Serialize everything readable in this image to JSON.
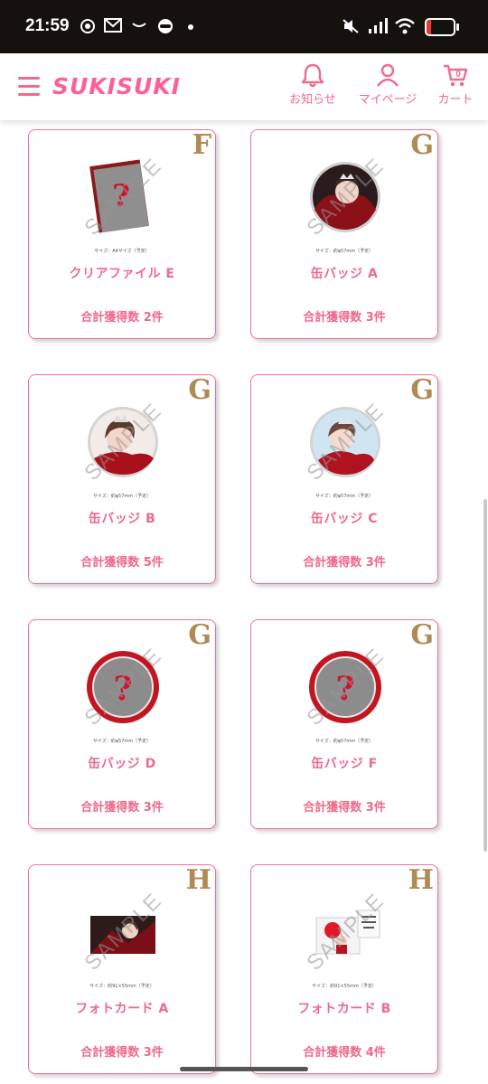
{
  "status_bar": {
    "time": "21:59",
    "battery": "17",
    "battery_level": 0.17,
    "icons": [
      "record-icon",
      "mail-icon",
      "wave-icon",
      "app-icon",
      "dot-icon",
      "mute-icon",
      "signal-icon",
      "wifi-icon",
      "battery-icon"
    ]
  },
  "header": {
    "logo": "SUKISUKI",
    "nav": [
      {
        "label": "お知らせ",
        "icon": "bell-icon"
      },
      {
        "label": "マイページ",
        "icon": "user-icon"
      },
      {
        "label": "カート",
        "icon": "cart-icon",
        "badge": "0"
      }
    ]
  },
  "colors": {
    "accent": "#ef6a8c",
    "rank": "#b08a55",
    "status_bar": "#15120e"
  },
  "watermark": "SAMPLE",
  "cards": [
    {
      "rank": "F",
      "name": "クリアファイル E",
      "count": "合計獲得数 2件",
      "caption": "サイズ：A4サイズ（予定）",
      "thumb": "clear-file"
    },
    {
      "rank": "G",
      "name": "缶バッジ A",
      "count": "合計獲得数 3件",
      "caption": "サイズ：約φ57mm（予定）",
      "thumb": "badge-photo-dark"
    },
    {
      "rank": "G",
      "name": "缶バッジ B",
      "count": "合計獲得数 5件",
      "caption": "サイズ：約φ57mm（予定）",
      "thumb": "badge-photo-light"
    },
    {
      "rank": "G",
      "name": "缶バッジ C",
      "count": "合計獲得数 3件",
      "caption": "サイズ：約φ57mm（予定）",
      "thumb": "badge-photo-blue"
    },
    {
      "rank": "G",
      "name": "缶バッジ D",
      "count": "合計獲得数 3件",
      "caption": "サイズ：約φ57mm（予定）",
      "thumb": "badge-mystery"
    },
    {
      "rank": "G",
      "name": "缶バッジ F",
      "count": "合計獲得数 3件",
      "caption": "サイズ：約φ57mm（予定）",
      "thumb": "badge-mystery"
    },
    {
      "rank": "H",
      "name": "フォトカード A",
      "count": "合計獲得数 3件",
      "caption": "サイズ：約91×55mm（予定）",
      "thumb": "photocard-a"
    },
    {
      "rank": "H",
      "name": "フォトカード B",
      "count": "合計獲得数 4件",
      "caption": "サイズ：約91×55mm（予定）",
      "thumb": "photocard-b"
    }
  ]
}
